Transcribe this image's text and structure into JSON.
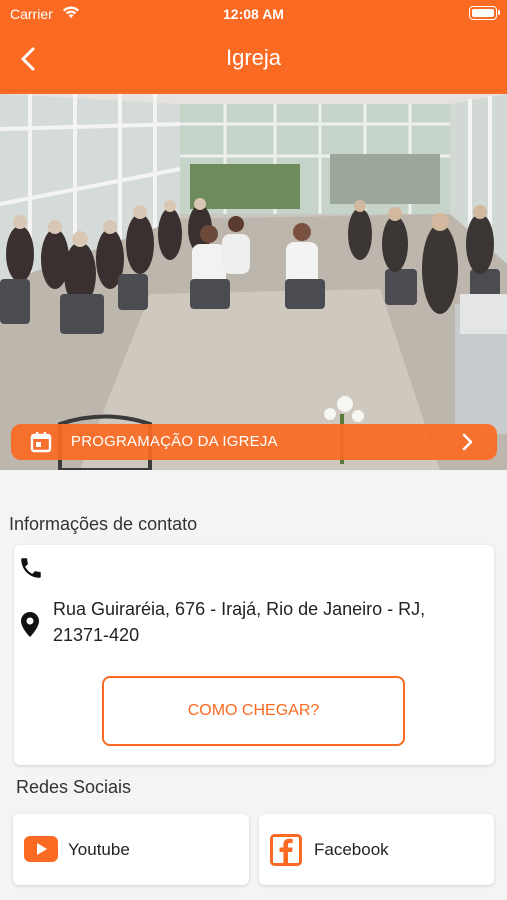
{
  "status_bar": {
    "carrier": "Carrier",
    "time": "12:08 AM"
  },
  "header": {
    "title": "Igreja"
  },
  "program": {
    "label": "PROGRAMAÇÃO DA IGREJA"
  },
  "contact": {
    "section_title": "Informações de contato",
    "address": "Rua Guiraréia, 676 - Irajá, Rio de Janeiro - RJ, 21371-420",
    "route_label": "COMO CHEGAR?"
  },
  "social": {
    "section_title": "Redes Sociais",
    "youtube_label": "Youtube",
    "facebook_label": "Facebook"
  },
  "colors": {
    "accent": "#fb6a22"
  }
}
